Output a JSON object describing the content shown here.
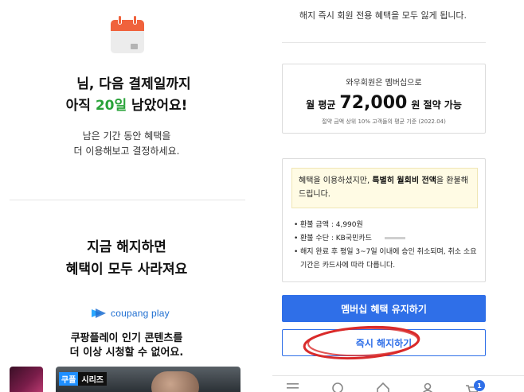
{
  "left": {
    "headline_1": "님, 다음 결제일까지",
    "headline_2_prefix": "아직 ",
    "headline_2_days": "20일",
    "headline_2_suffix": " 남았어요!",
    "sub_1": "남은 기간 동안 혜택을",
    "sub_2": "더 이용해보고 결정하세요.",
    "warn_1": "지금 해지하면",
    "warn_2": "혜택이 모두 사라져요",
    "coupang_play_logo": "coupang play",
    "cp_text_1": "쿠팡플레이 인기 콘텐츠를",
    "cp_text_2": "더 이상 시청할 수 없어요.",
    "badge_brand": "쿠플",
    "badge_series": "시리즈",
    "accent_color": "#2aa33a",
    "icons": [
      "calendar-icon",
      "coupang-play-icon"
    ]
  },
  "right": {
    "top_text": "해지 즉시 회원 전용 혜택을 모두 잃게 됩니다.",
    "savings_label": "와우회원은 멤버십으로",
    "savings_prefix": "월 평균",
    "savings_amount": "72,000",
    "savings_suffix": "원 절약 가능",
    "savings_note": "절약 금액 상위 10% 고객들의 평균 기준 (2022.04)",
    "notice_pre": "혜택을 이용하셨지만, ",
    "notice_bold": "특별히 월회비 전액",
    "notice_post": "을 환불해 드립니다.",
    "refund_amount": "환불 금액 : 4,990원",
    "refund_method": "환불 수단 : KB국민카드",
    "refund_note": "해지 완료 후 평일 3~7일 이내에 승인 취소되며, 취소 소요기간은 카드사에 따라 다릅니다.",
    "keep_button": "멤버십 혜택 유지하기",
    "cancel_button": "즉시 해지하기",
    "cart_count": "1",
    "primary_color": "#2f6fe8",
    "annotation_color": "#d92b2b",
    "tabbar_icons": [
      "menu-icon",
      "search-icon",
      "home-icon",
      "user-icon",
      "cart-icon"
    ]
  }
}
